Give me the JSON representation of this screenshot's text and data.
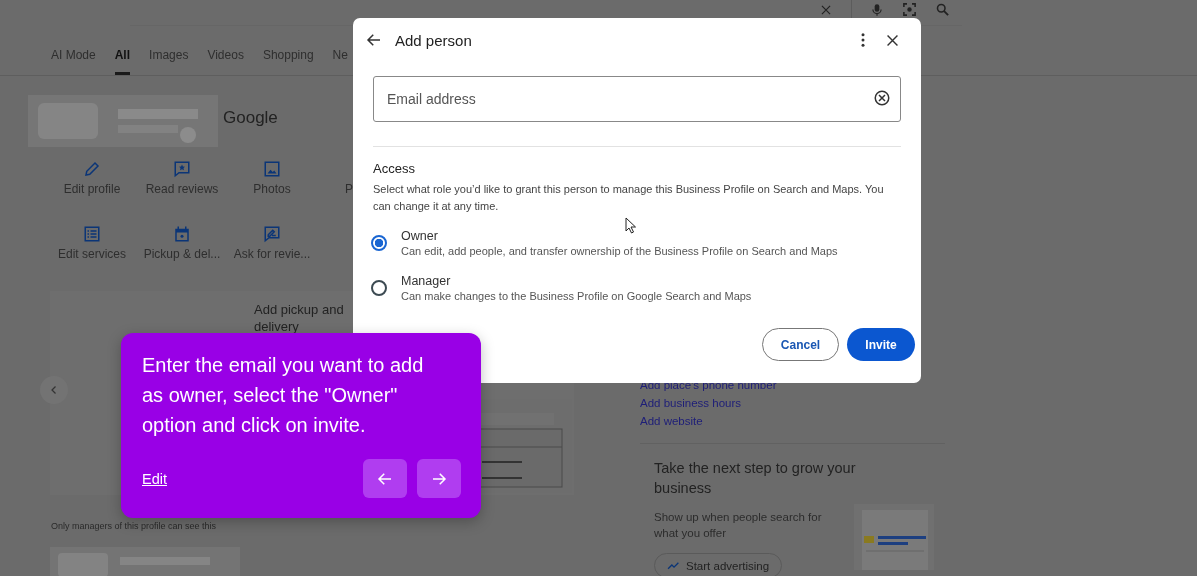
{
  "tabs": [
    {
      "label": "AI Mode",
      "selected": false
    },
    {
      "label": "All",
      "selected": true
    },
    {
      "label": "Images",
      "selected": false
    },
    {
      "label": "Videos",
      "selected": false
    },
    {
      "label": "Shopping",
      "selected": false
    },
    {
      "label": "Ne",
      "selected": false
    }
  ],
  "business": {
    "name": "Google"
  },
  "actions": [
    {
      "label": "Edit profile"
    },
    {
      "label": "Read reviews"
    },
    {
      "label": "Photos"
    },
    {
      "label": "P"
    },
    {
      "label": "Edit services"
    },
    {
      "label": "Pickup & del..."
    },
    {
      "label": "Ask for revie..."
    }
  ],
  "promo_card": {
    "title": "Add pickup and delivery"
  },
  "note": "Only managers of this profile can see this",
  "links": [
    "Add place's phone number",
    "Add business hours",
    "Add website"
  ],
  "grow_card": {
    "title": "Take the next step to grow your business",
    "text": "Show up when people search for what you offer",
    "button": "Start advertising"
  },
  "dialog": {
    "title": "Add person",
    "email_field": {
      "placeholder": "Email address"
    },
    "access": {
      "heading": "Access",
      "description": "Select what role you’d like to grant this person to manage this Business Profile on Search and Maps. You can change it at any time.",
      "options": [
        {
          "label": "Owner",
          "description": "Can edit, add people, and transfer ownership of the Business Profile on Search and Maps",
          "selected": true
        },
        {
          "label": "Manager",
          "description": "Can make changes to the Business Profile on Google Search and Maps",
          "selected": false
        }
      ]
    },
    "cancel_button": "Cancel",
    "invite_button": "Invite"
  },
  "tooltip": {
    "text": "Enter the email you want to add as owner, select the \"Owner\" option and click on invite.",
    "link": "Edit"
  }
}
